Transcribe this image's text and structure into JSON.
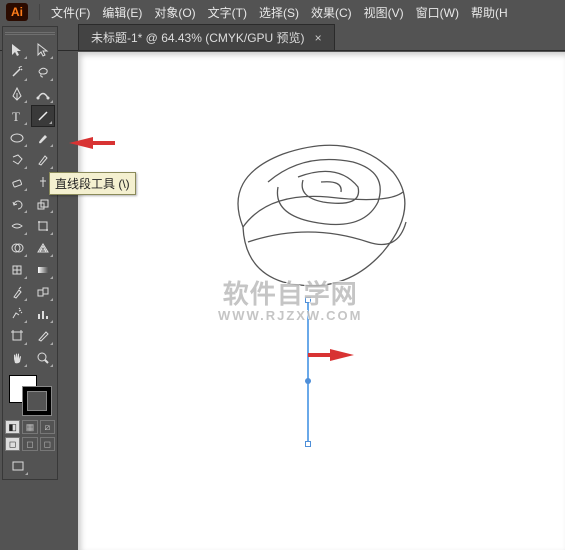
{
  "app": {
    "logo_text": "Ai"
  },
  "menu": {
    "file": "文件(F)",
    "edit": "编辑(E)",
    "object": "对象(O)",
    "type": "文字(T)",
    "select": "选择(S)",
    "effect": "效果(C)",
    "view": "视图(V)",
    "window": "窗口(W)",
    "help": "帮助(H"
  },
  "tab": {
    "label": "未标题-1* @ 64.43%  (CMYK/GPU 预览)",
    "close": "×"
  },
  "tooltip": {
    "line_tool": "直线段工具 (\\)"
  },
  "watermark": {
    "main": "软件自学网",
    "sub": "WWW.RJZXW.COM"
  },
  "icons": {
    "selection": "selection-tool",
    "direct": "direct-selection-tool",
    "wand": "magic-wand-tool",
    "lasso": "lasso-tool",
    "pen": "pen-tool",
    "curvature": "curvature-tool",
    "type": "type-tool",
    "line": "line-segment-tool",
    "ellipse": "ellipse-tool",
    "brush": "paintbrush-tool",
    "shaper": "shaper-tool",
    "pencil": "pencil-tool",
    "eraser": "eraser-tool",
    "scissors": "scissors-tool",
    "rotate": "rotate-tool",
    "scale": "scale-tool",
    "width": "width-tool",
    "warp": "warp-tool",
    "freetrans": "free-transform-tool",
    "shapebuilder": "shape-builder-tool",
    "perspective": "perspective-grid-tool",
    "mesh": "mesh-tool",
    "gradient": "gradient-tool",
    "eyedrop": "eyedropper-tool",
    "blend": "blend-tool",
    "symbol": "symbol-sprayer-tool",
    "graph": "column-graph-tool",
    "artboard": "artboard-tool",
    "slice": "slice-tool",
    "hand": "hand-tool",
    "zoom": "zoom-tool"
  }
}
